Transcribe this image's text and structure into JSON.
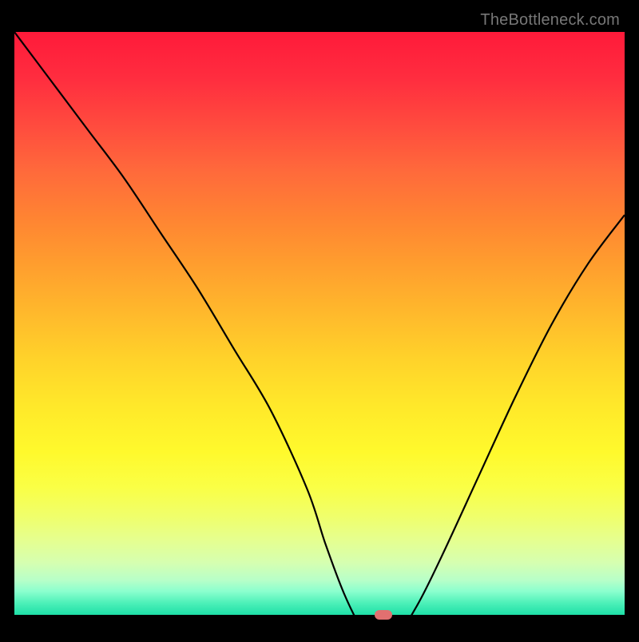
{
  "watermark": "TheBottleneck.com",
  "chart_data": {
    "type": "line",
    "title": "",
    "xlabel": "",
    "ylabel": "",
    "xlim": [
      0,
      100
    ],
    "ylim": [
      0,
      100
    ],
    "grid": false,
    "series": [
      {
        "name": "bottleneck-curve",
        "x": [
          0,
          6,
          12,
          18,
          24,
          30,
          36,
          42,
          48,
          51,
          54,
          57,
          59,
          62,
          66,
          70,
          76,
          82,
          88,
          94,
          100
        ],
        "values": [
          100,
          92,
          84,
          76,
          67,
          58,
          48,
          38,
          25,
          16,
          8,
          2,
          0,
          0,
          6,
          14,
          27,
          40,
          52,
          62,
          70
        ]
      }
    ],
    "marker": {
      "x": 60.5,
      "y": 0
    },
    "background_gradient_stops": [
      {
        "pct": 0,
        "color": "#ff1a3a"
      },
      {
        "pct": 40,
        "color": "#ff9e2e"
      },
      {
        "pct": 72,
        "color": "#fff92c"
      },
      {
        "pct": 100,
        "color": "#1ee0a8"
      }
    ]
  }
}
